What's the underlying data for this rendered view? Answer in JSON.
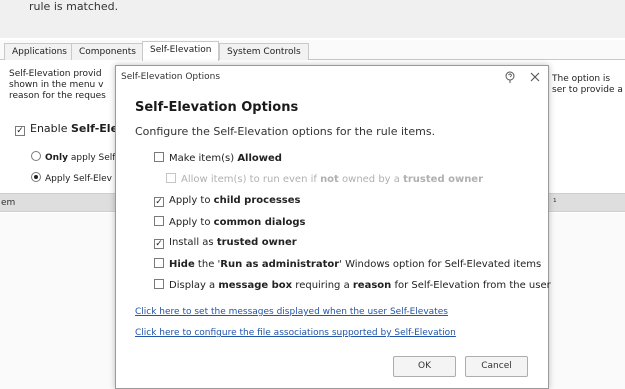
{
  "background": {
    "top_text": "rule is matched.",
    "tabs": [
      {
        "label": "Applications"
      },
      {
        "label": "Components"
      },
      {
        "label": "Self-Elevation"
      },
      {
        "label": "System Controls"
      }
    ],
    "desc_lines": [
      "Self-Elevation provid",
      "shown in the menu v",
      "reason for the reques"
    ],
    "desc_right_lines": [
      "The option is",
      "ser to provide a"
    ],
    "enable_prefix": "Enable ",
    "enable_bold": "Self-Elev",
    "radio_only_bold": "Only",
    "radio_only_rest": " apply Self",
    "radio_apply": "Apply Self-Elev",
    "strip_left": "em",
    "strip_right": "¹"
  },
  "dialog": {
    "title": "Self-Elevation Options",
    "heading": "Self-Elevation Options",
    "subtitle": "Configure the Self-Elevation options for the rule items.",
    "options": {
      "allowed": {
        "pre": "Make item(s) ",
        "bold": "Allowed",
        "post": "",
        "checked": false
      },
      "allow_run": {
        "pre": "Allow item(s) to run even if ",
        "bold": "not",
        "mid": " owned by a ",
        "bold2": "trusted owner",
        "checked": false
      },
      "child": {
        "pre": "Apply to ",
        "bold": "child processes",
        "post": "",
        "checked": true
      },
      "common": {
        "pre": "Apply to ",
        "bold": "common dialogs",
        "post": "",
        "checked": false
      },
      "trusted": {
        "pre": "Install as ",
        "bold": "trusted owner",
        "post": "",
        "checked": true
      },
      "hide": {
        "pre": "",
        "bold": "Hide",
        "mid": " the '",
        "bold2": "Run as administrator",
        "post": "' Windows option for Self-Elevated items",
        "checked": false
      },
      "msgbox": {
        "pre": "Display a ",
        "bold": "message box",
        "mid": " requiring a ",
        "bold2": "reason",
        "post": " for Self-Elevation from the user",
        "checked": false
      }
    },
    "link_messages": "Click here to set the messages displayed when the user Self-Elevates",
    "link_associations": "Click here to configure the file associations supported by Self-Elevation",
    "ok_label": "OK",
    "cancel_label": "Cancel",
    "check_glyph": "✓"
  }
}
